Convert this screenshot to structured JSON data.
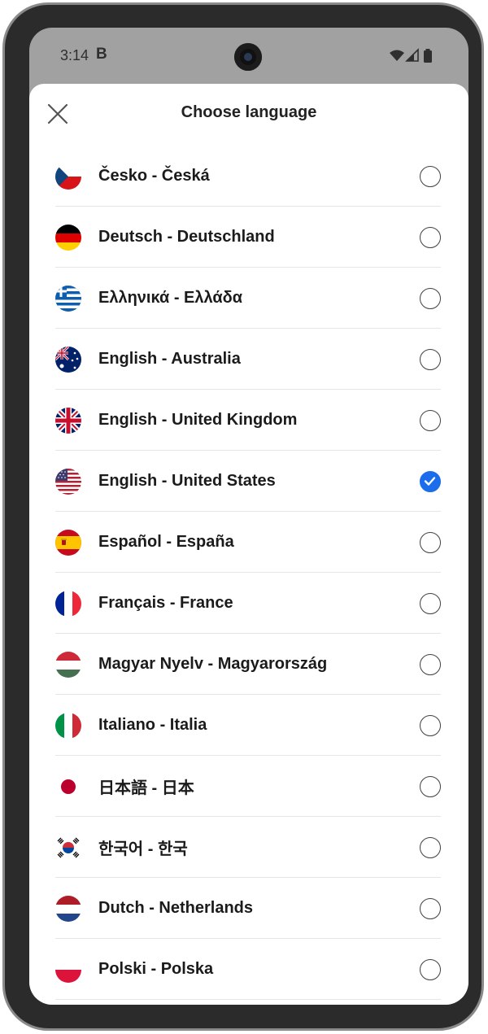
{
  "status_bar": {
    "time": "3:14",
    "notification_icon": "B"
  },
  "header": {
    "title": "Choose language",
    "close_icon": "close-icon"
  },
  "accent_color": "#1b6dec",
  "languages": [
    {
      "label": "Česko - Česká",
      "flag": "cz",
      "selected": false
    },
    {
      "label": "Deutsch - Deutschland",
      "flag": "de",
      "selected": false
    },
    {
      "label": "Ελληνικά - Ελλάδα",
      "flag": "gr",
      "selected": false
    },
    {
      "label": "English - Australia",
      "flag": "au",
      "selected": false
    },
    {
      "label": "English - United Kingdom",
      "flag": "gb",
      "selected": false
    },
    {
      "label": "English - United States",
      "flag": "us",
      "selected": true
    },
    {
      "label": "Español - España",
      "flag": "es",
      "selected": false
    },
    {
      "label": "Français - France",
      "flag": "fr",
      "selected": false
    },
    {
      "label": "Magyar Nyelv - Magyarország",
      "flag": "hu",
      "selected": false
    },
    {
      "label": "Italiano - Italia",
      "flag": "it",
      "selected": false
    },
    {
      "label": "日本語 - 日本",
      "flag": "jp",
      "selected": false
    },
    {
      "label": "한국어 - 한국",
      "flag": "kr",
      "selected": false
    },
    {
      "label": "Dutch - Netherlands",
      "flag": "nl",
      "selected": false
    },
    {
      "label": "Polski - Polska",
      "flag": "pl",
      "selected": false
    }
  ]
}
